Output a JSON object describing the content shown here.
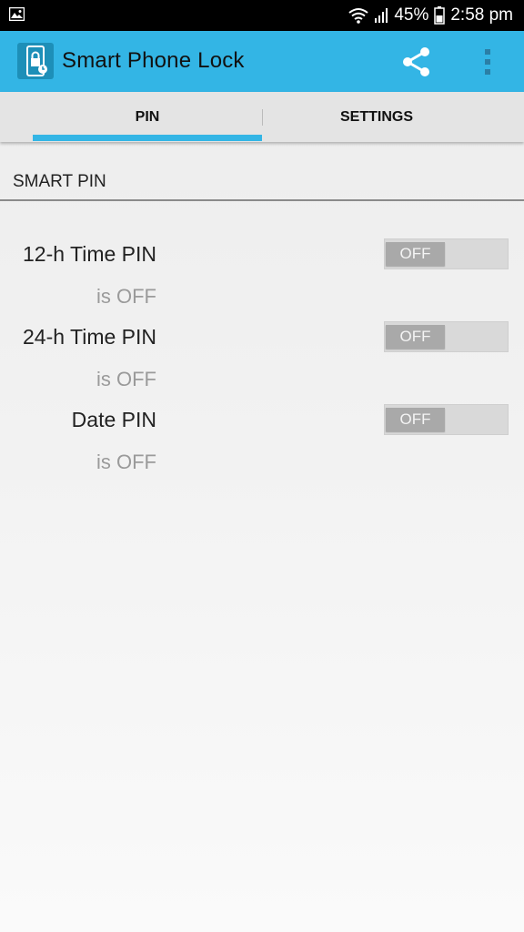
{
  "status_bar": {
    "left_icon": "gallery-icon",
    "battery_percent": "45%",
    "time": "2:58 pm",
    "icons": [
      "wifi-icon",
      "signal-icon",
      "battery-icon"
    ]
  },
  "app_bar": {
    "title": "Smart Phone Lock",
    "icon": "app-lock-icon",
    "actions": [
      "share-icon",
      "more-options-icon"
    ],
    "color": "#33b5e5"
  },
  "tabs": [
    {
      "label": "PIN",
      "selected": true
    },
    {
      "label": "SETTINGS",
      "selected": false
    }
  ],
  "section": {
    "title": "SMART PIN"
  },
  "pins": [
    {
      "label": "12-h Time PIN",
      "summary": "is OFF",
      "toggle": "OFF"
    },
    {
      "label": "24-h Time PIN",
      "summary": "is OFF",
      "toggle": "OFF"
    },
    {
      "label": "Date PIN",
      "summary": "is OFF",
      "toggle": "OFF"
    }
  ]
}
